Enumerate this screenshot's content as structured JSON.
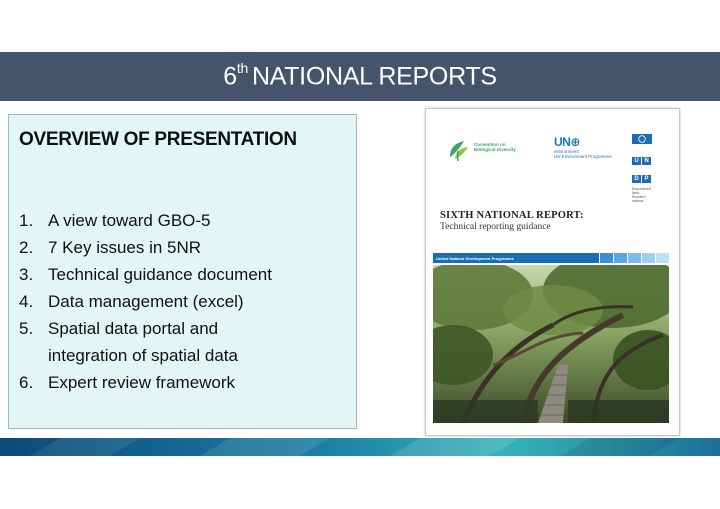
{
  "title": {
    "number": "6",
    "superscript": "th",
    "text": "NATIONAL REPORTS"
  },
  "overview": {
    "heading": "OVERVIEW OF PRESENTATION",
    "items": [
      {
        "num": "1.",
        "lines": [
          "A view toward GBO-5"
        ]
      },
      {
        "num": "2.",
        "lines": [
          "7 Key issues in 5NR"
        ]
      },
      {
        "num": "3.",
        "lines": [
          "Technical guidance document"
        ]
      },
      {
        "num": "4.",
        "lines": [
          "Data management (excel)"
        ]
      },
      {
        "num": "5.",
        "lines": [
          "Spatial data portal and",
          "integration of spatial data"
        ]
      },
      {
        "num": "6.",
        "lines": [
          "Expert review framework"
        ]
      }
    ]
  },
  "cover": {
    "cbd_text": [
      "Convention on",
      "Biological Diversity"
    ],
    "un_env": {
      "big": "UN",
      "line1": "environment",
      "line2": "UN Environment Programme"
    },
    "undp": {
      "letters": [
        "U",
        "N",
        "D",
        "P"
      ],
      "sub": "Empowered lives. Resilient nations."
    },
    "title": "SIXTH NATIONAL REPORT:",
    "subtitle": "Technical reporting guidance",
    "strip_label": "United Nations Development Programme"
  },
  "colors": {
    "title_bar": "#44546a",
    "overview_bg": "#e2f6f6",
    "band_dark": "#0c4a7a",
    "band_light": "#35b3b6"
  }
}
